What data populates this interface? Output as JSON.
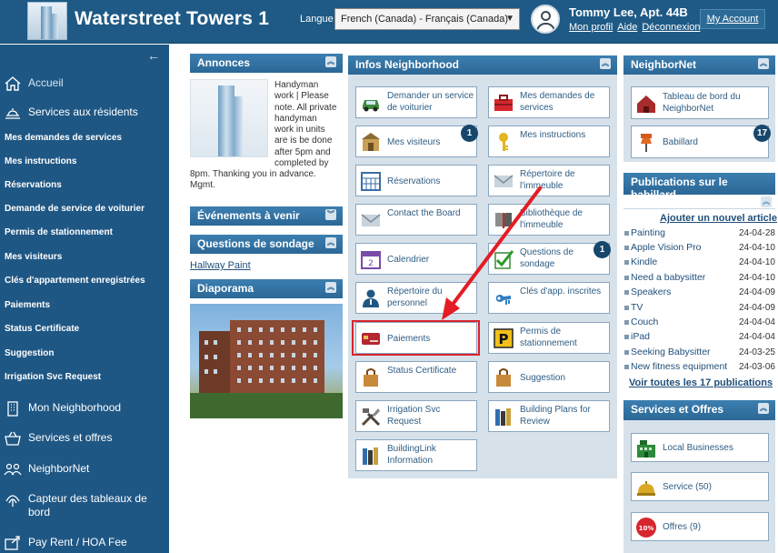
{
  "header": {
    "site_title": "Waterstreet Towers 1",
    "language_label": "Langue :",
    "language_value": "French (Canada) - Français (Canada)",
    "user_name": "Tommy Lee, Apt. 44B",
    "links": {
      "profile": "Mon profil",
      "help": "Aide",
      "logout": "Déconnexion"
    },
    "my_account": "My Account"
  },
  "sidebar": {
    "collapse_glyph": "←",
    "main": [
      {
        "label": "Accueil",
        "icon": "home-icon"
      },
      {
        "label": "Services aux résidents",
        "icon": "services-icon"
      }
    ],
    "sub": [
      "Mes demandes de services",
      "Mes instructions",
      "Réservations",
      "Demande de service de voiturier",
      "Permis de stationnement",
      "Mes visiteurs",
      "Clés d'appartement enregistrées",
      "Paiements",
      "Status Certificate",
      "Suggestion",
      "Irrigation Svc Request"
    ],
    "bottom": [
      {
        "label": "Mon Neighborhood",
        "icon": "building-icon"
      },
      {
        "label": "Services et offres",
        "icon": "basket-icon"
      },
      {
        "label": "NeighborNet",
        "icon": "people-icon"
      },
      {
        "label": "Capteur des tableaux de bord",
        "icon": "sensor-icon"
      },
      {
        "label": "Pay Rent / HOA Fee",
        "icon": "pay-icon"
      }
    ]
  },
  "annonces": {
    "title": "Annonces",
    "lines_right": [
      "Handyman",
      "work | Please",
      "note. All private",
      "handyman",
      "work in units",
      "are is be done",
      "after 5pm and",
      "completed by"
    ],
    "lines_full": [
      "8pm. Thanking you in advance.",
      "Mgmt."
    ]
  },
  "evenements": {
    "title": "Événements à venir"
  },
  "sondage": {
    "title": "Questions de sondage",
    "link": "Hallway Paint"
  },
  "diaporama": {
    "title": "Diaporama"
  },
  "infos": {
    "title": "Infos Neighborhood",
    "tiles": [
      {
        "label": "Demander un service de voiturier",
        "icon": "car-icon"
      },
      {
        "label": "Mes demandes de services",
        "icon": "toolbox-icon"
      },
      {
        "label": "Mes visiteurs",
        "icon": "visitors-icon",
        "badge": "1"
      },
      {
        "label": "Mes instructions",
        "icon": "key-icon"
      },
      {
        "label": "Réservations",
        "icon": "calendar-grid-icon"
      },
      {
        "label": "Répertoire de l'immeuble",
        "icon": "envelope-icon"
      },
      {
        "label": "Contact the Board",
        "icon": "envelope-icon"
      },
      {
        "label": "Bibliothèque de l'immeuble",
        "icon": "book-icon"
      },
      {
        "label": "Calendrier",
        "icon": "calendar-icon"
      },
      {
        "label": "Questions de sondage",
        "icon": "checklist-icon",
        "badge": "1"
      },
      {
        "label": "Répertoire du personnel",
        "icon": "staff-icon"
      },
      {
        "label": "Clés d'app. inscrites",
        "icon": "keys-icon"
      },
      {
        "label": "Paiements",
        "icon": "card-icon"
      },
      {
        "label": "Permis de stationnement",
        "icon": "parking-icon"
      },
      {
        "label": "Status Certificate",
        "icon": "bag-icon"
      },
      {
        "label": "Suggestion",
        "icon": "bag-icon"
      },
      {
        "label": "Irrigation Svc Request",
        "icon": "tools-icon"
      },
      {
        "label": "Building Plans for Review",
        "icon": "books-icon"
      },
      {
        "label": "BuildingLink Information",
        "icon": "books-icon"
      }
    ]
  },
  "neighbornet": {
    "title": "NeighborNet",
    "tiles": [
      {
        "label": "Tableau de bord du NeighborNet",
        "icon": "house-red-icon"
      },
      {
        "label": "Babillard",
        "icon": "pin-icon",
        "badge": "17"
      }
    ]
  },
  "publications": {
    "title": "Publications sur le babillard",
    "add_link": "Ajouter un nouvel article",
    "items": [
      {
        "title": "Painting",
        "date": "24-04-28"
      },
      {
        "title": "Apple Vision Pro",
        "date": "24-04-10"
      },
      {
        "title": "Kindle",
        "date": "24-04-10"
      },
      {
        "title": "Need a babysitter",
        "date": "24-04-10"
      },
      {
        "title": "Speakers",
        "date": "24-04-09"
      },
      {
        "title": "TV",
        "date": "24-04-09"
      },
      {
        "title": "Couch",
        "date": "24-04-04"
      },
      {
        "title": "iPad",
        "date": "24-04-04"
      },
      {
        "title": "Seeking Babysitter",
        "date": "24-03-25"
      },
      {
        "title": "New fitness equipment",
        "date": "24-03-06"
      }
    ],
    "all_link": "Voir toutes les 17 publications"
  },
  "services_offres": {
    "title": "Services et Offres",
    "tiles": [
      {
        "label": "Local Businesses",
        "icon": "shop-icon"
      },
      {
        "label": "Service (50)",
        "icon": "bell-icon"
      },
      {
        "label": "Offres (9)",
        "icon": "percent-icon",
        "badge_text": "10%"
      }
    ]
  },
  "toggle_glyph": "︽",
  "toggle_down_glyph": "︾",
  "colors": {
    "header": "#1e5a85",
    "sidebar": "#1f5784",
    "panel_head": "#2b6796",
    "highlight": "#d9232d"
  }
}
